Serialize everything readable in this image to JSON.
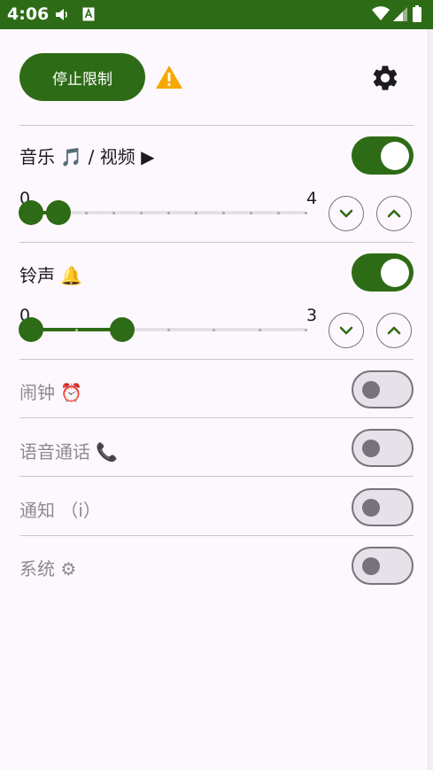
{
  "status_bar": {
    "time": "4:06",
    "icons": [
      "volume-icon",
      "text-a-icon",
      "wifi-icon",
      "cell-signal-icon",
      "battery-icon"
    ]
  },
  "colors": {
    "primary": "#2e6b16",
    "background": "#fdf8fd",
    "warning": "#f5a800",
    "outline": "#77737d",
    "track_inactive": "#e5e0e8"
  },
  "header": {
    "stop_button_label": "停止限制",
    "warning_icon": "warning-icon",
    "settings_icon": "gear-icon"
  },
  "streams": [
    {
      "id": "music",
      "label": "音乐 🎵 / 视频 ▶",
      "enabled": true,
      "slider": {
        "min": "0",
        "max": "4",
        "min_value": 0,
        "max_value": 10,
        "low": 0,
        "high": 1
      }
    },
    {
      "id": "ringtone",
      "label": "铃声 🔔",
      "enabled": true,
      "slider": {
        "min": "0",
        "max": "3",
        "min_value": 0,
        "max_value": 6,
        "low": 0,
        "high": 2
      }
    },
    {
      "id": "alarm",
      "label": "闹钟 ⏰",
      "enabled": false
    },
    {
      "id": "voice_call",
      "label": "语音通话 📞",
      "enabled": false
    },
    {
      "id": "notification",
      "label": "通知 （i）",
      "enabled": false
    },
    {
      "id": "system",
      "label": "系统 ⚙",
      "enabled": false
    }
  ]
}
